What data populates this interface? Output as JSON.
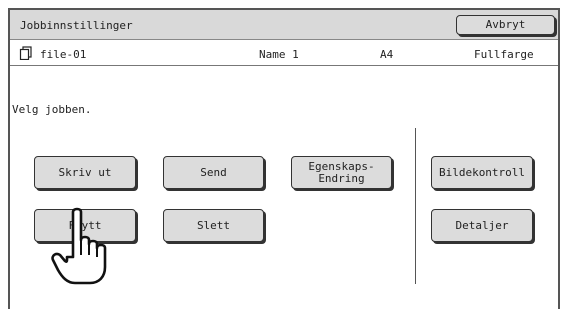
{
  "header": {
    "title": "Jobbinnstillinger",
    "cancel_label": "Avbryt"
  },
  "file": {
    "icon": "document-stack-icon",
    "name": "file-01",
    "user": "Name 1",
    "paper_size": "A4",
    "color_mode": "Fullfarge"
  },
  "prompt": "Velg jobben.",
  "actions": {
    "print": "Skriv ut",
    "send": "Send",
    "property_change": "Egenskaps-\nEndring",
    "move": "Flytt",
    "delete": "Slett",
    "image_check": "Bildekontroll",
    "details": "Detaljer"
  },
  "pointer": {
    "icon": "hand-pointer-icon",
    "target": "Flytt"
  }
}
